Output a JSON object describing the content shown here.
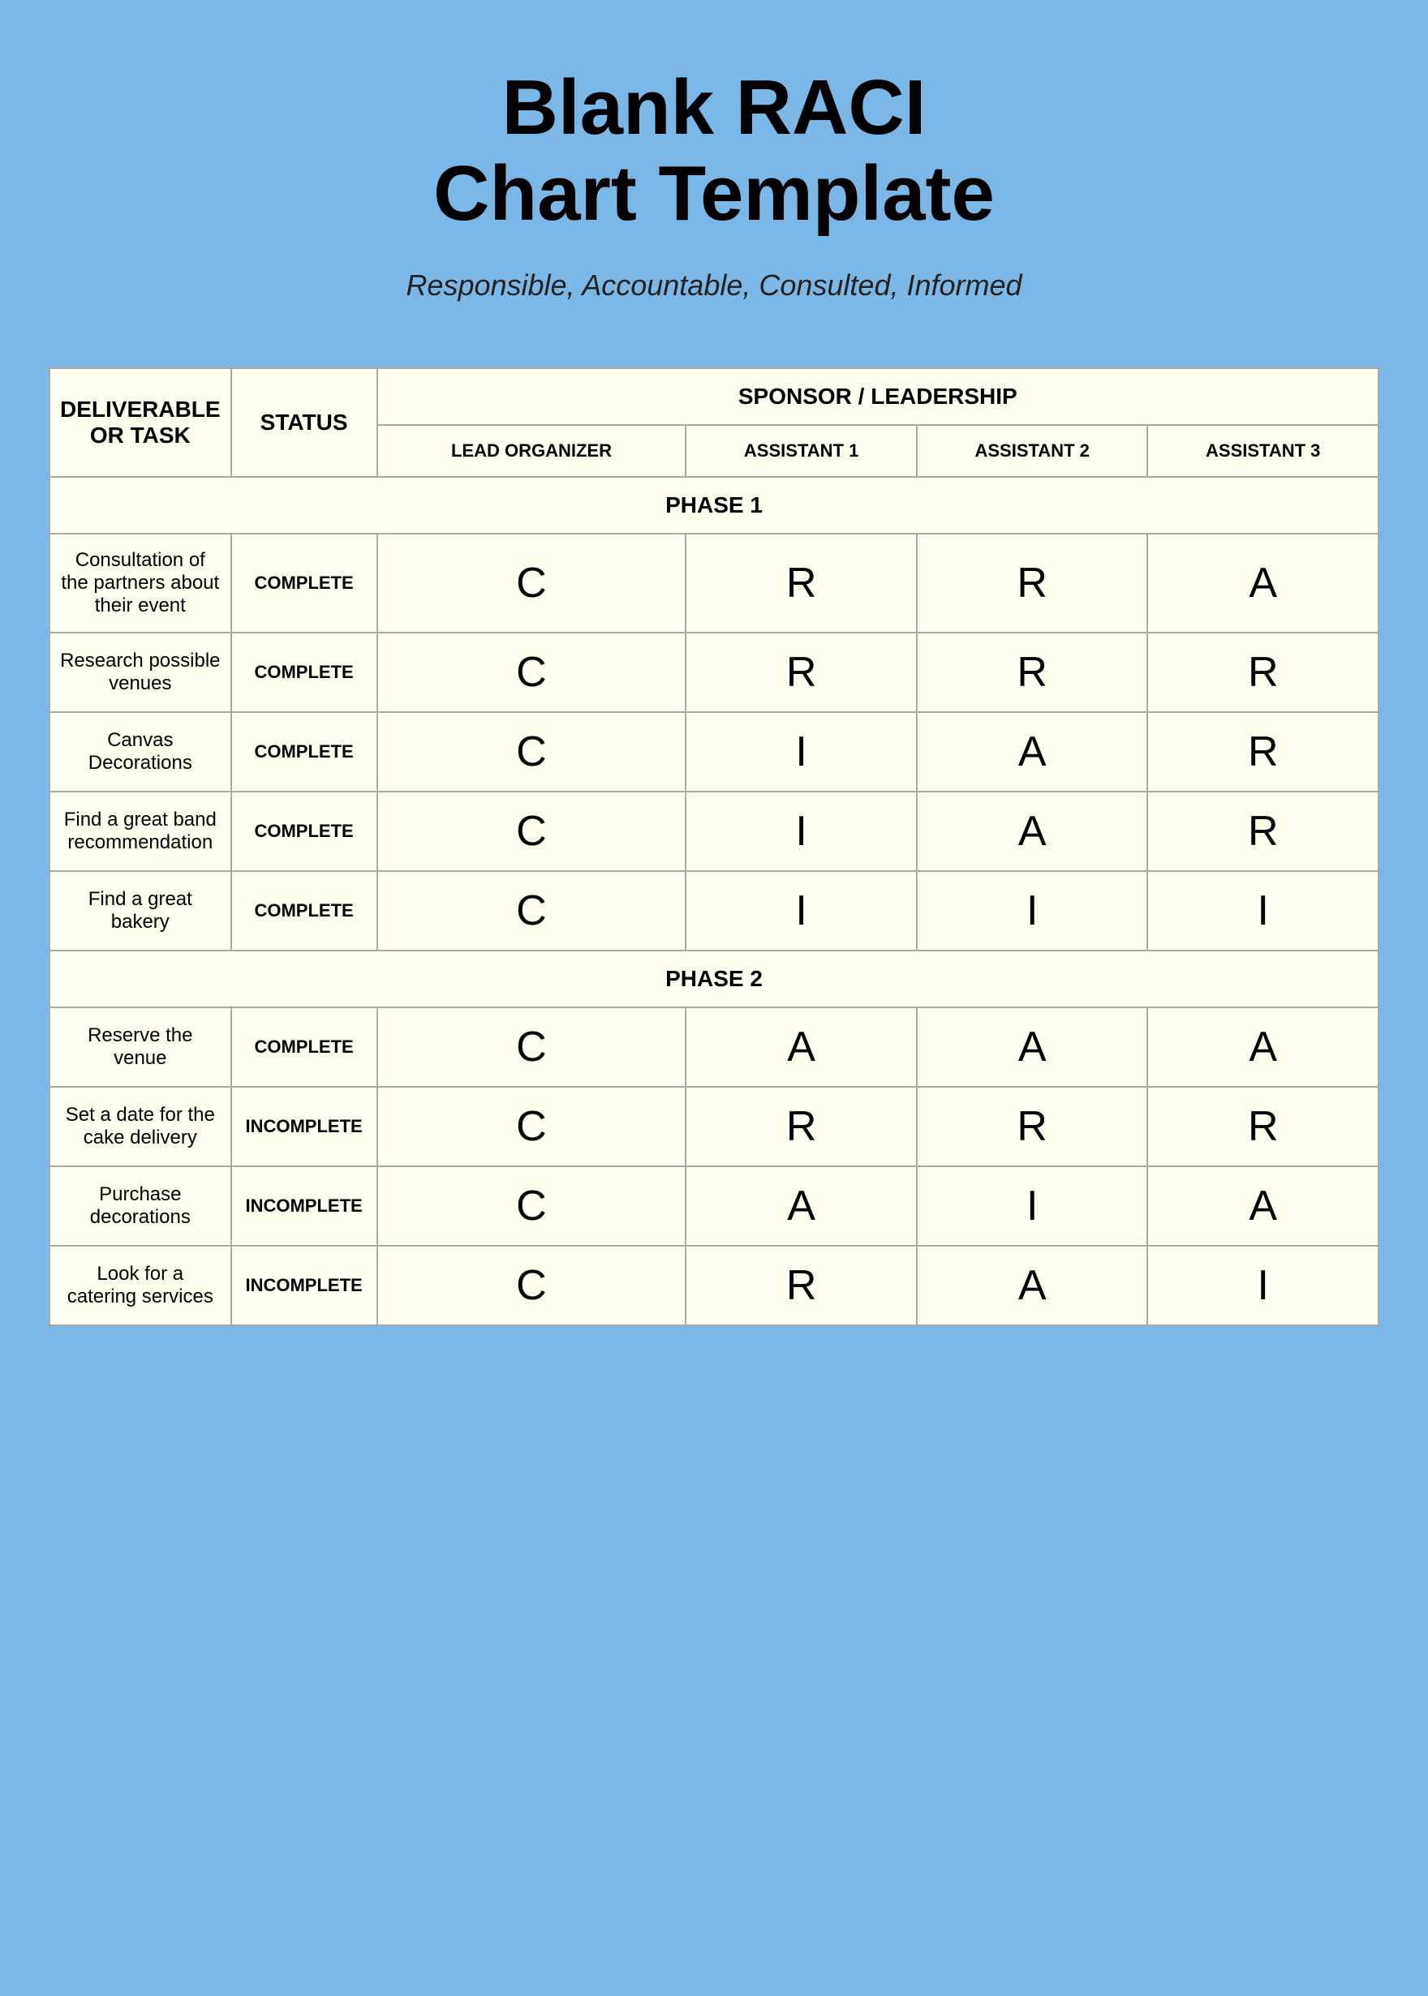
{
  "title": {
    "line1": "Blank RACI",
    "line2": "Chart Template"
  },
  "subtitle": "Responsible, Accountable, Consulted, Informed",
  "table": {
    "headers": {
      "col1": "DELIVERABLE OR TASK",
      "col2": "STATUS",
      "col3": "SPONSOR / LEADERSHIP"
    },
    "subheaders": {
      "phase": "PHASE 1",
      "lead": "LEAD ORGANIZER",
      "a1": "ASSISTANT 1",
      "a2": "ASSISTANT 2",
      "a3": "ASSISTANT 3"
    },
    "phase1": {
      "label": "PHASE 1",
      "rows": [
        {
          "task": "Consultation of the partners about their event",
          "status": "COMPLETE",
          "lead": "C",
          "a1": "R",
          "a2": "R",
          "a3": "A"
        },
        {
          "task": "Research possible venues",
          "status": "COMPLETE",
          "lead": "C",
          "a1": "R",
          "a2": "R",
          "a3": "R"
        },
        {
          "task": "Canvas Decorations",
          "status": "COMPLETE",
          "lead": "C",
          "a1": "I",
          "a2": "A",
          "a3": "R"
        },
        {
          "task": "Find a great band recommendation",
          "status": "COMPLETE",
          "lead": "C",
          "a1": "I",
          "a2": "A",
          "a3": "R"
        },
        {
          "task": "Find a great bakery",
          "status": "COMPLETE",
          "lead": "C",
          "a1": "I",
          "a2": "I",
          "a3": "I"
        }
      ]
    },
    "phase2": {
      "label": "PHASE 2",
      "rows": [
        {
          "task": "Reserve the venue",
          "status": "COMPLETE",
          "lead": "C",
          "a1": "A",
          "a2": "A",
          "a3": "A"
        },
        {
          "task": "Set a date for the cake delivery",
          "status": "INCOMPLETE",
          "lead": "C",
          "a1": "R",
          "a2": "R",
          "a3": "R"
        },
        {
          "task": "Purchase decorations",
          "status": "INCOMPLETE",
          "lead": "C",
          "a1": "A",
          "a2": "I",
          "a3": "A"
        },
        {
          "task": "Look for a catering services",
          "status": "INCOMPLETE",
          "lead": "C",
          "a1": "R",
          "a2": "A",
          "a3": "I"
        }
      ]
    }
  }
}
